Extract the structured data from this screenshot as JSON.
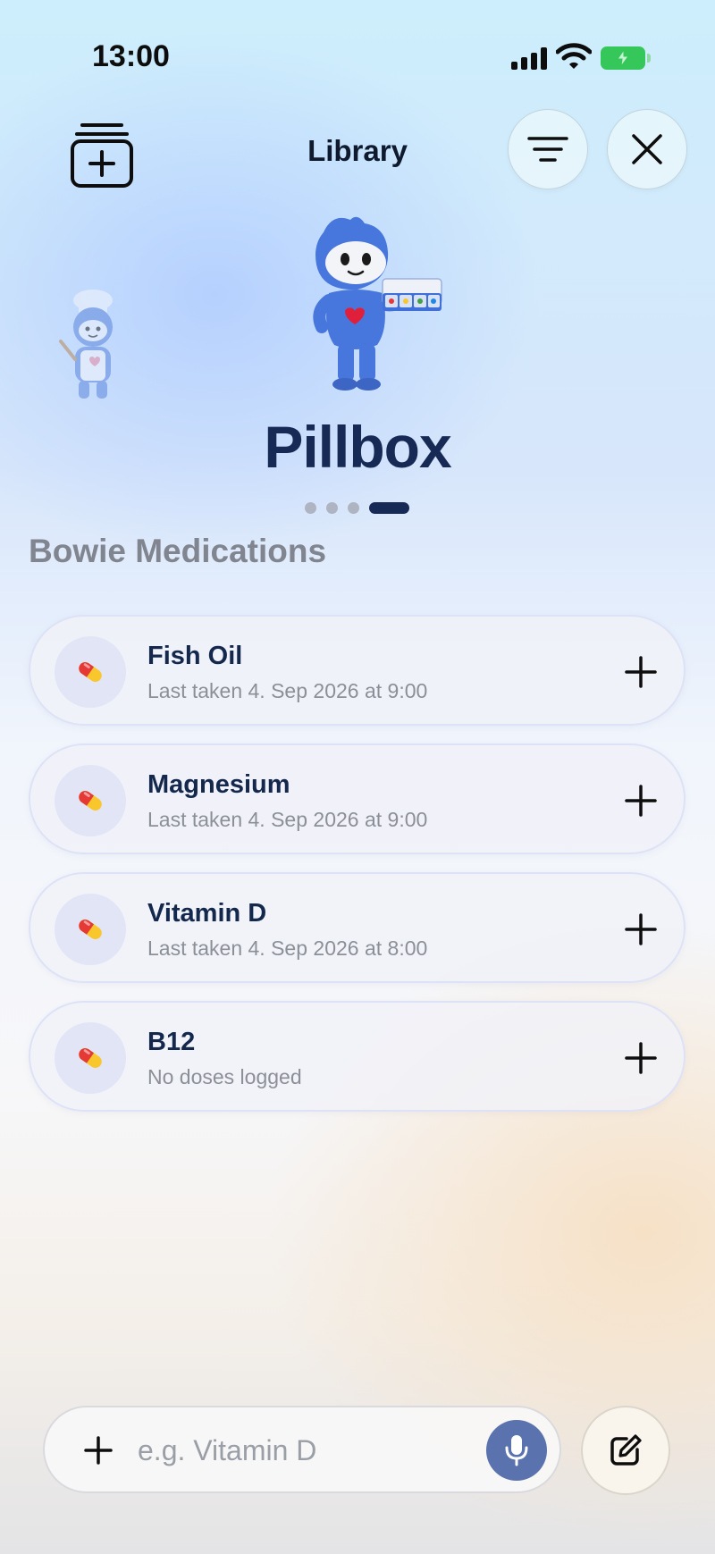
{
  "status_bar": {
    "time": "13:00"
  },
  "header": {
    "title": "Library"
  },
  "hero": {
    "brand": "Pillbox",
    "pages": 4,
    "active_page": 4
  },
  "section": {
    "title": "Bowie Medications"
  },
  "medications": [
    {
      "name": "Fish Oil",
      "subtitle": "Last taken 4. Sep 2026 at 9:00"
    },
    {
      "name": "Magnesium",
      "subtitle": "Last taken 4. Sep 2026 at 9:00"
    },
    {
      "name": "Vitamin D",
      "subtitle": "Last taken 4. Sep 2026 at 8:00"
    },
    {
      "name": "B12",
      "subtitle": "No doses logged"
    }
  ],
  "composer": {
    "placeholder": "e.g. Vitamin D"
  },
  "icons": {
    "add_library": "add-library-icon",
    "filter": "filter-lines-icon",
    "close": "close-icon",
    "pill": "pill-capsule-icon",
    "plus": "plus-icon",
    "mic": "microphone-icon",
    "compose": "compose-icon"
  },
  "colors": {
    "brand_navy": "#162a55",
    "battery_green": "#35c759",
    "mic_blue": "#5a72ad",
    "capsule_red": "#e53935",
    "capsule_yellow": "#f9c62b"
  }
}
